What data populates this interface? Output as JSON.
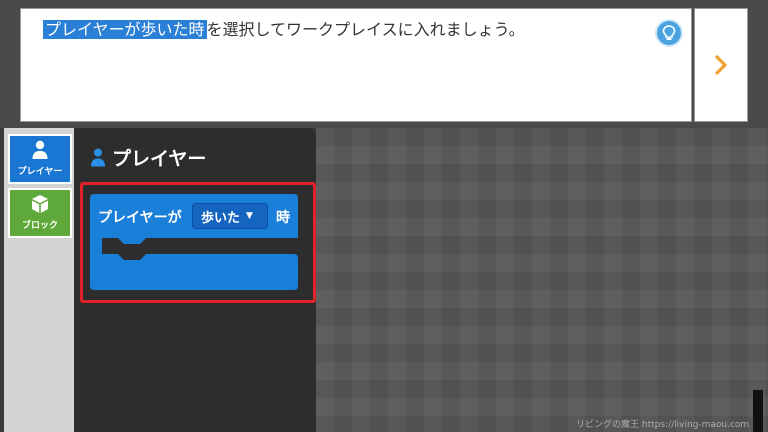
{
  "tutorial": {
    "highlight": "プレイヤーが歩いた時",
    "rest": "を選択してワークプレイスに入れましょう。"
  },
  "categories": [
    {
      "label": "プレイヤー",
      "icon": "person-icon",
      "color": "#1976d2"
    },
    {
      "label": "ブロック",
      "icon": "cube-icon",
      "color": "#5fa83a"
    }
  ],
  "flyout": {
    "title": "プレイヤー"
  },
  "block": {
    "prefix": "プレイヤーが",
    "dropdown_value": "歩いた",
    "suffix": "時",
    "color": "#1a7fd8"
  },
  "watermark": "リビングの魔王 https://living-maou.com",
  "colors": {
    "selection": "#e2222a",
    "hint": "#4aa3e0",
    "next_arrow": "#f0a030"
  }
}
